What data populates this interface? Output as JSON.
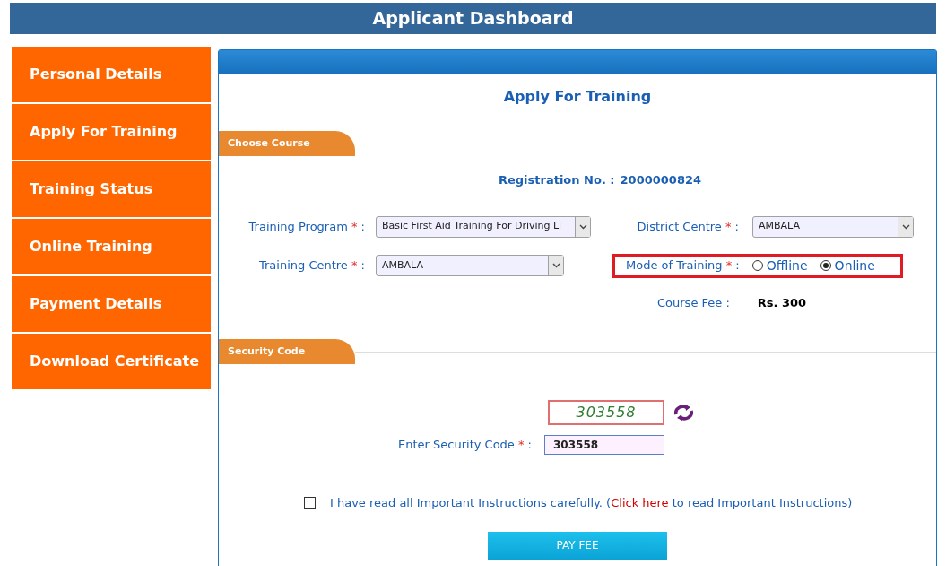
{
  "header": {
    "title": "Applicant Dashboard"
  },
  "sidebar": {
    "items": [
      {
        "label": "Personal Details",
        "selected": false
      },
      {
        "label": "Apply For Training",
        "selected": false
      },
      {
        "label": "Training Status",
        "selected": false
      },
      {
        "label": "Online Training",
        "selected": false
      },
      {
        "label": "Payment Details",
        "selected": false
      },
      {
        "label": "Download Certificate",
        "selected": false
      }
    ]
  },
  "panel": {
    "title": "Apply For Training"
  },
  "choose_course": {
    "tab": "Choose Course",
    "registration": {
      "label": "Registration No. :",
      "value": "2000000824"
    },
    "fields": [
      {
        "label": "Training Program",
        "required_mark": "*",
        "separator": ":",
        "value": "Basic First Aid Training For Driving Li"
      },
      {
        "label": "District Centre",
        "required_mark": "*",
        "separator": ":",
        "value": "AMBALA"
      },
      {
        "label": "Training Centre",
        "required_mark": "*",
        "separator": ":",
        "value": "AMBALA"
      }
    ],
    "mode": {
      "label": "Mode of Training",
      "required_mark": "*",
      "separator": ":",
      "options": [
        {
          "label": "Offline",
          "selected": false
        },
        {
          "label": "Online",
          "selected": true
        }
      ]
    },
    "course_fee": {
      "label": "Course Fee :",
      "value": "Rs. 300"
    }
  },
  "security": {
    "tab": "Security Code",
    "captcha": "303558",
    "field": {
      "label": "Enter Security Code",
      "required_mark": "*",
      "separator": ":",
      "value": "303558"
    },
    "agreement": {
      "checked": false,
      "text_before": "I have read all Important Instructions carefully. (",
      "link": "Click here",
      "text_after": "to read Important Instructions)"
    },
    "button": "PAY FEE"
  }
}
